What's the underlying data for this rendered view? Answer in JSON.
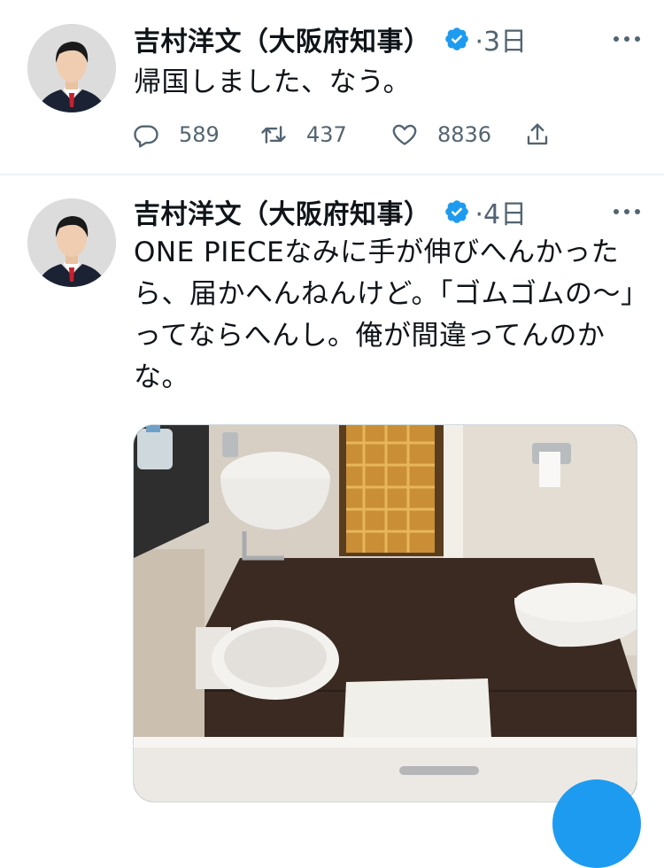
{
  "tweets": [
    {
      "author": "吉村洋文（大阪府知事）",
      "time": "·3日",
      "text": "帰国しました、なう。",
      "replies": "589",
      "retweets": "437",
      "likes": "8836"
    },
    {
      "author": "吉村洋文（大阪府知事）",
      "time": "·4日",
      "text": "ONE PIECEなみに手が伸びへんかったら、届かへんねんけど。「ゴムゴムの〜」ってならへんし。俺が間違ってんのかな。"
    }
  ],
  "colors": {
    "verified": "#1d9bf0",
    "secondary_text": "#536471",
    "divider": "#eff3f4"
  },
  "icons": [
    "verified-badge-icon",
    "more-icon",
    "reply-icon",
    "retweet-icon",
    "like-icon",
    "share-icon"
  ]
}
